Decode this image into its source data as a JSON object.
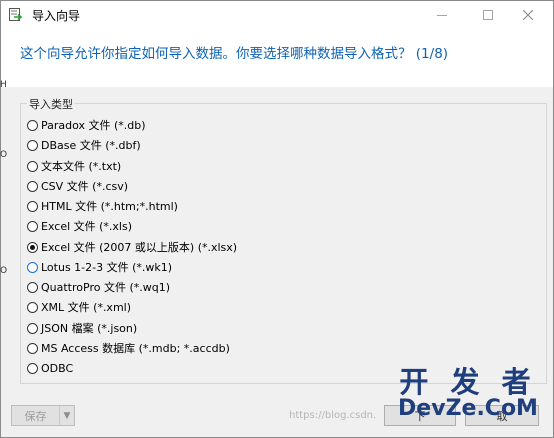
{
  "window": {
    "title": "导入向导"
  },
  "heading": "这个向导允许你指定如何导入数据。你要选择哪种数据导入格式？ (1/8)",
  "import_type": {
    "legend": "导入类型",
    "options": [
      {
        "label": "Paradox 文件 (*.db)",
        "checked": false
      },
      {
        "label": "DBase 文件 (*.dbf)",
        "checked": false
      },
      {
        "label": "文本文件 (*.txt)",
        "checked": false
      },
      {
        "label": "CSV 文件 (*.csv)",
        "checked": false
      },
      {
        "label": "HTML 文件 (*.htm;*.html)",
        "checked": false
      },
      {
        "label": "Excel 文件 (*.xls)",
        "checked": false
      },
      {
        "label": "Excel 文件 (2007 或以上版本) (*.xlsx)",
        "checked": true
      },
      {
        "label": "Lotus 1-2-3 文件 (*.wk1)",
        "checked": false
      },
      {
        "label": "QuattroPro 文件 (*.wq1)",
        "checked": false
      },
      {
        "label": "XML 文件 (*.xml)",
        "checked": false
      },
      {
        "label": "JSON 檔案 (*.json)",
        "checked": false
      },
      {
        "label": "MS Access 数据库 (*.mdb; *.accdb)",
        "checked": false
      },
      {
        "label": "ODBC",
        "checked": false
      }
    ]
  },
  "footer": {
    "save_label": "保存",
    "next_label": "下",
    "cancel_label": "取"
  },
  "watermark": {
    "url_text": "https://blog.csdn.",
    "logo_zh": "开 发 者",
    "logo_en": "DevZe.CoM"
  },
  "background_fragments": [
    "H",
    "O",
    "O"
  ]
}
